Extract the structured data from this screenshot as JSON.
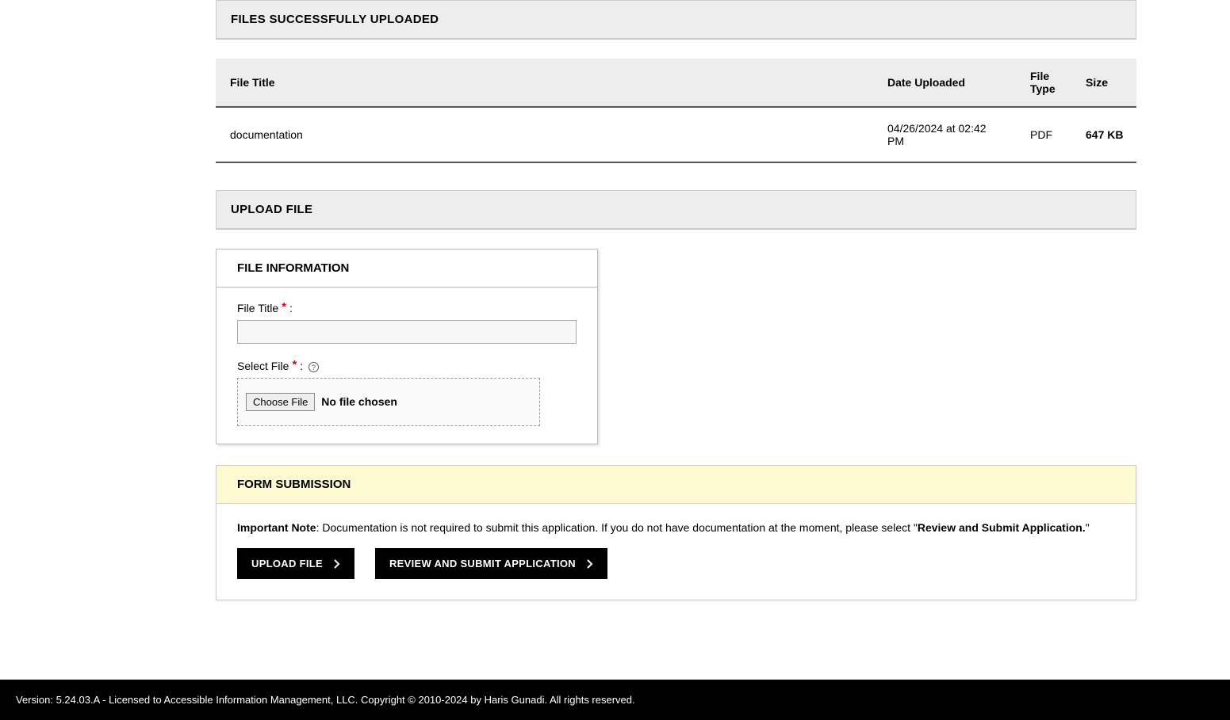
{
  "files_uploaded": {
    "header": "FILES SUCCESSFULLY UPLOADED",
    "columns": {
      "title": "File Title",
      "date": "Date Uploaded",
      "type": "File Type",
      "size": "Size"
    },
    "rows": [
      {
        "title": "documentation",
        "date": "04/26/2024 at 02:42 PM",
        "type": "PDF",
        "size": "647 KB"
      }
    ]
  },
  "upload": {
    "header": "UPLOAD FILE",
    "file_info_header": "FILE INFORMATION",
    "file_title_label": "File Title",
    "select_file_label": "Select File",
    "choose_file_button": "Choose File",
    "no_file_text": "No file chosen"
  },
  "submission": {
    "header": "FORM SUBMISSION",
    "note_label": "Important Note",
    "note_text": ": Documentation is not required to submit this application. If you do not have documentation at the moment, please select \"",
    "note_action": "Review and Submit Application.",
    "note_end": "\"",
    "upload_button": "UPLOAD FILE",
    "review_button": "REVIEW AND SUBMIT APPLICATION"
  },
  "footer": {
    "text": "Version: 5.24.03.A - Licensed to Accessible Information Management, LLC. Copyright © 2010-2024 by Haris Gunadi. All rights reserved."
  }
}
